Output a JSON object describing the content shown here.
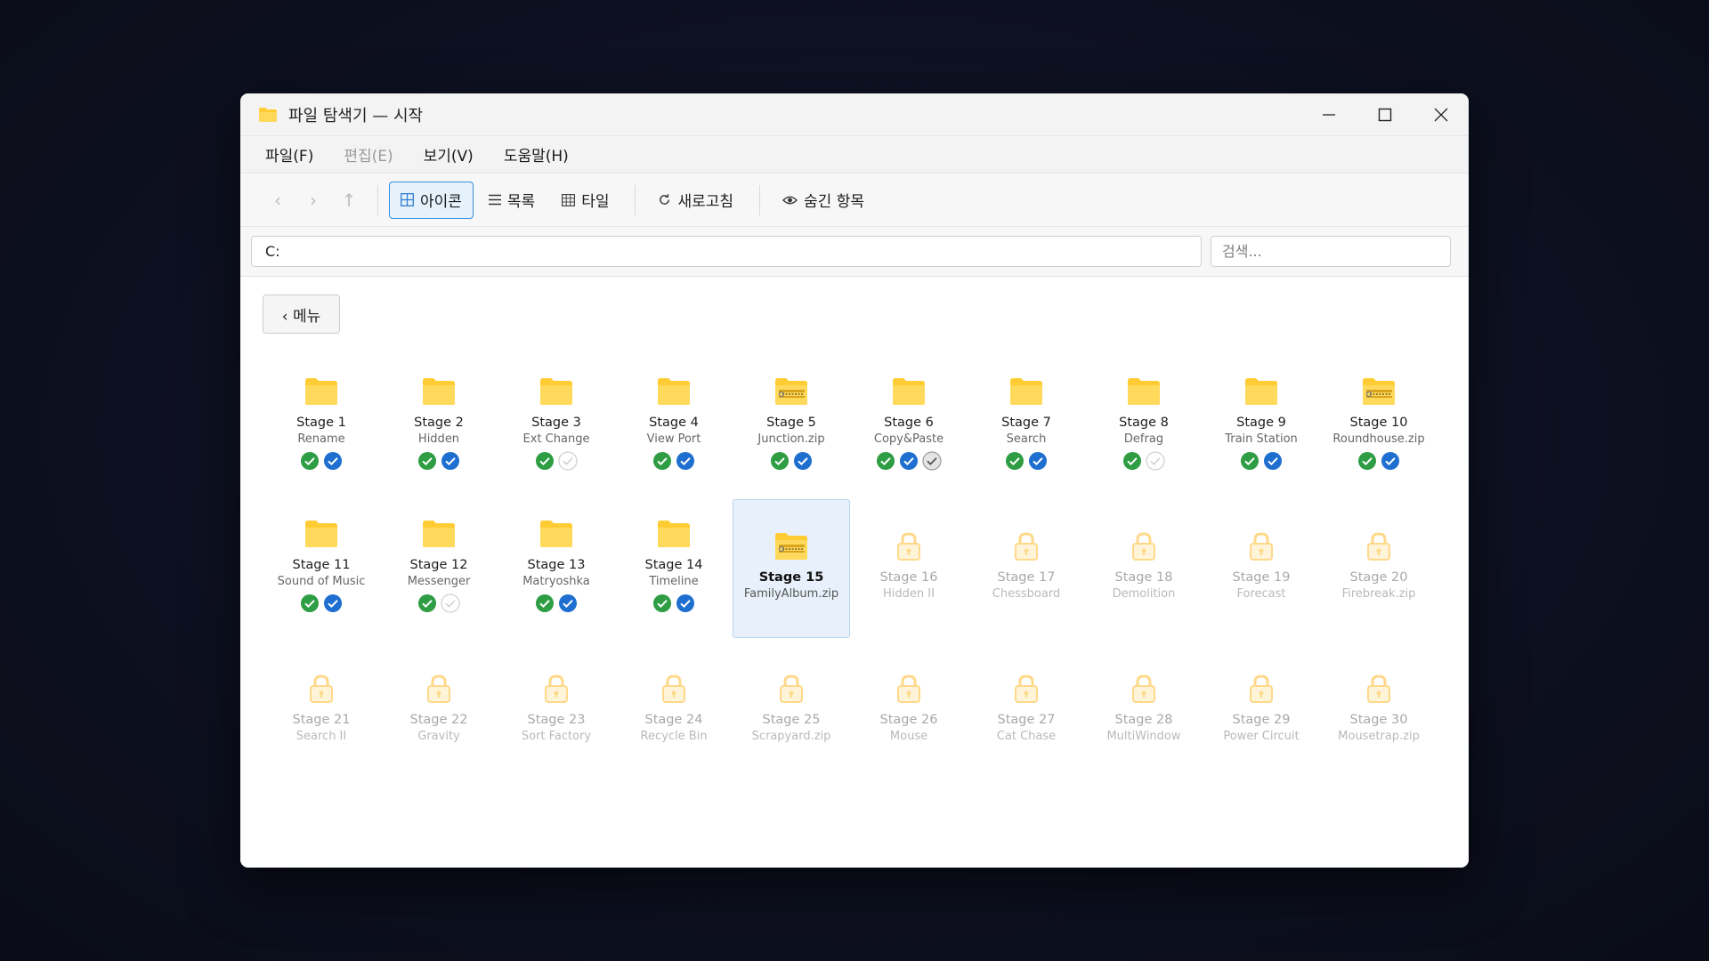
{
  "window": {
    "title": "파일 탐색기 — 시작",
    "controls": [
      "minimize-icon",
      "maximize-icon",
      "close-icon"
    ]
  },
  "menu": {
    "file": "파일(F)",
    "edit": "편집(E)",
    "view": "보기(V)",
    "help": "도움말(H)"
  },
  "toolbar": {
    "back": "‹",
    "forward": "›",
    "up": "↑",
    "icons": "아이콘",
    "list": "목록",
    "tiles": "타일",
    "refresh": "새로고침",
    "hidden": "숨긴 항목",
    "active_view": "아이콘"
  },
  "address": {
    "path": "C:",
    "search_placeholder": "검색..."
  },
  "content": {
    "back_button": "‹ 메뉴"
  },
  "colors": {
    "folder": "#ffcc33",
    "check_green": "#2e9d43",
    "check_blue": "#1e6fd0",
    "accent": "#3c8fd8"
  },
  "stages": [
    {
      "name": "Stage 1",
      "sub": "Rename",
      "state": "folder",
      "badges": [
        "green",
        "blue"
      ]
    },
    {
      "name": "Stage 2",
      "sub": "Hidden",
      "state": "folder",
      "badges": [
        "green",
        "blue"
      ]
    },
    {
      "name": "Stage 3",
      "sub": "Ext Change",
      "state": "folder",
      "badges": [
        "green",
        "empty"
      ]
    },
    {
      "name": "Stage 4",
      "sub": "View Port",
      "state": "folder",
      "badges": [
        "green",
        "blue"
      ]
    },
    {
      "name": "Stage 5",
      "sub": "Junction.zip",
      "state": "zip",
      "badges": [
        "green",
        "blue"
      ]
    },
    {
      "name": "Stage 6",
      "sub": "Copy&Paste",
      "state": "folder",
      "badges": [
        "green",
        "blue",
        "gray"
      ]
    },
    {
      "name": "Stage 7",
      "sub": "Search",
      "state": "folder",
      "badges": [
        "green",
        "blue"
      ]
    },
    {
      "name": "Stage 8",
      "sub": "Defrag",
      "state": "folder",
      "badges": [
        "green",
        "empty"
      ]
    },
    {
      "name": "Stage 9",
      "sub": "Train Station",
      "state": "folder",
      "badges": [
        "green",
        "blue"
      ]
    },
    {
      "name": "Stage 10",
      "sub": "Roundhouse.zip",
      "state": "zip",
      "badges": [
        "green",
        "blue"
      ]
    },
    {
      "name": "Stage 11",
      "sub": "Sound of Music",
      "state": "folder",
      "badges": [
        "green",
        "blue"
      ]
    },
    {
      "name": "Stage 12",
      "sub": "Messenger",
      "state": "folder",
      "badges": [
        "green",
        "empty"
      ]
    },
    {
      "name": "Stage 13",
      "sub": "Matryoshka",
      "state": "folder",
      "badges": [
        "green",
        "blue"
      ]
    },
    {
      "name": "Stage 14",
      "sub": "Timeline",
      "state": "folder",
      "badges": [
        "green",
        "blue"
      ]
    },
    {
      "name": "Stage 15",
      "sub": "FamilyAlbum.zip",
      "state": "zip-selected",
      "badges": []
    },
    {
      "name": "Stage 16",
      "sub": "Hidden II",
      "state": "locked",
      "badges": []
    },
    {
      "name": "Stage 17",
      "sub": "Chessboard",
      "state": "locked",
      "badges": []
    },
    {
      "name": "Stage 18",
      "sub": "Demolition",
      "state": "locked",
      "badges": []
    },
    {
      "name": "Stage 19",
      "sub": "Forecast",
      "state": "locked",
      "badges": []
    },
    {
      "name": "Stage 20",
      "sub": "Firebreak.zip",
      "state": "locked",
      "badges": []
    },
    {
      "name": "Stage 21",
      "sub": "Search II",
      "state": "locked",
      "badges": []
    },
    {
      "name": "Stage 22",
      "sub": "Gravity",
      "state": "locked",
      "badges": []
    },
    {
      "name": "Stage 23",
      "sub": "Sort Factory",
      "state": "locked",
      "badges": []
    },
    {
      "name": "Stage 24",
      "sub": "Recycle Bin",
      "state": "locked",
      "badges": []
    },
    {
      "name": "Stage 25",
      "sub": "Scrapyard.zip",
      "state": "locked",
      "badges": []
    },
    {
      "name": "Stage 26",
      "sub": "Mouse",
      "state": "locked",
      "badges": []
    },
    {
      "name": "Stage 27",
      "sub": "Cat Chase",
      "state": "locked",
      "badges": []
    },
    {
      "name": "Stage 28",
      "sub": "MultiWindow",
      "state": "locked",
      "badges": []
    },
    {
      "name": "Stage 29",
      "sub": "Power Circuit",
      "state": "locked",
      "badges": []
    },
    {
      "name": "Stage 30",
      "sub": "Mousetrap.zip",
      "state": "locked",
      "badges": []
    }
  ]
}
